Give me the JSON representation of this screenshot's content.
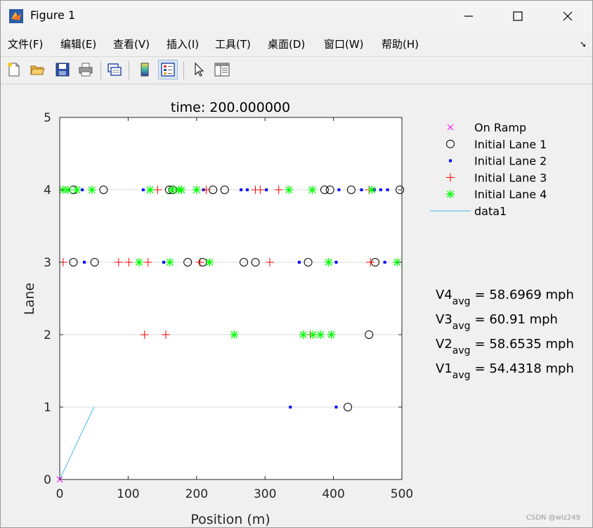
{
  "window": {
    "title": "Figure 1",
    "minimize_label": "—",
    "maximize_label": "☐",
    "close_label": "✕"
  },
  "menu": [
    "文件(F)",
    "编辑(E)",
    "查看(V)",
    "插入(I)",
    "工具(T)",
    "桌面(D)",
    "窗口(W)",
    "帮助(H)"
  ],
  "toolbar": {
    "icons": [
      "new-figure-icon",
      "open-file-icon",
      "save-icon",
      "print-icon",
      "link-plot-icon",
      "colorbar-icon",
      "legend-icon",
      "pointer-icon",
      "property-inspector-icon"
    ]
  },
  "colors": {
    "on_ramp": "#ff00ff",
    "lane1": "#000000",
    "lane2": "#0000ff",
    "lane3": "#ff0000",
    "lane4": "#00ff00",
    "data1": "#4db8e8"
  },
  "chart_data": {
    "type": "scatter",
    "title": "time: 200.000000",
    "xlabel": "Position (m)",
    "ylabel": "Lane",
    "xlim": [
      0,
      500
    ],
    "ylim": [
      0,
      5
    ],
    "xticks": [
      0,
      100,
      200,
      300,
      400,
      500
    ],
    "yticks": [
      0,
      1,
      2,
      3,
      4,
      5
    ],
    "grid": "horizontal",
    "legend_position": "outside-right",
    "series": [
      {
        "name": "On Ramp",
        "marker": "x",
        "points": [
          [
            0,
            0
          ]
        ]
      },
      {
        "name": "Initial Lane 1",
        "marker": "o",
        "points": [
          [
            20,
            4
          ],
          [
            64,
            4
          ],
          [
            160,
            4
          ],
          [
            165,
            4
          ],
          [
            224,
            4
          ],
          [
            241,
            4
          ],
          [
            387,
            4
          ],
          [
            395,
            4
          ],
          [
            426,
            4
          ],
          [
            497,
            4
          ],
          [
            20,
            3
          ],
          [
            51,
            3
          ],
          [
            187,
            3
          ],
          [
            209,
            3
          ],
          [
            269,
            3
          ],
          [
            286,
            3
          ],
          [
            363,
            3
          ],
          [
            461,
            3
          ],
          [
            452,
            2
          ],
          [
            421,
            1
          ]
        ]
      },
      {
        "name": "Initial Lane 2",
        "marker": ".",
        "points": [
          [
            33,
            4
          ],
          [
            122,
            4
          ],
          [
            210,
            4
          ],
          [
            265,
            4
          ],
          [
            274,
            4
          ],
          [
            302,
            4
          ],
          [
            408,
            4
          ],
          [
            441,
            4
          ],
          [
            456,
            4
          ],
          [
            460,
            4
          ],
          [
            469,
            4
          ],
          [
            479,
            4
          ],
          [
            36,
            3
          ],
          [
            152,
            3
          ],
          [
            350,
            3
          ],
          [
            404,
            3
          ],
          [
            475,
            3
          ],
          [
            337,
            1
          ],
          [
            404,
            1
          ]
        ]
      },
      {
        "name": "Initial Lane 3",
        "marker": "+",
        "points": [
          [
            143,
            4
          ],
          [
            214,
            4
          ],
          [
            286,
            4
          ],
          [
            293,
            4
          ],
          [
            320,
            4
          ],
          [
            452,
            4
          ],
          [
            5,
            3
          ],
          [
            86,
            3
          ],
          [
            101,
            3
          ],
          [
            129,
            3
          ],
          [
            205,
            3
          ],
          [
            307,
            3
          ],
          [
            454,
            3
          ],
          [
            124,
            2
          ],
          [
            155,
            2
          ],
          [
            366,
            2
          ]
        ]
      },
      {
        "name": "Initial Lane 4",
        "marker": "*",
        "points": [
          [
            5,
            4
          ],
          [
            12,
            4
          ],
          [
            25,
            4
          ],
          [
            47,
            4
          ],
          [
            132,
            4
          ],
          [
            164,
            4
          ],
          [
            174,
            4
          ],
          [
            178,
            4
          ],
          [
            200,
            4
          ],
          [
            335,
            4
          ],
          [
            369,
            4
          ],
          [
            456,
            4
          ],
          [
            116,
            3
          ],
          [
            161,
            3
          ],
          [
            219,
            3
          ],
          [
            393,
            3
          ],
          [
            493,
            3
          ],
          [
            255,
            2
          ],
          [
            356,
            2
          ],
          [
            370,
            2
          ],
          [
            381,
            2
          ],
          [
            397,
            2
          ]
        ]
      },
      {
        "name": "data1",
        "marker": "line",
        "points": [
          [
            0,
            0
          ],
          [
            50,
            1
          ]
        ]
      }
    ],
    "annotations": [
      {
        "label": "V4",
        "sub": "avg",
        "text": "= 58.6969 mph"
      },
      {
        "label": "V3",
        "sub": "avg",
        "text": "= 60.91 mph"
      },
      {
        "label": "V2",
        "sub": "avg",
        "text": "= 58.6535 mph"
      },
      {
        "label": "V1",
        "sub": "avg",
        "text": "= 54.4318 mph"
      }
    ]
  },
  "watermark": "CSDN @wlz249"
}
